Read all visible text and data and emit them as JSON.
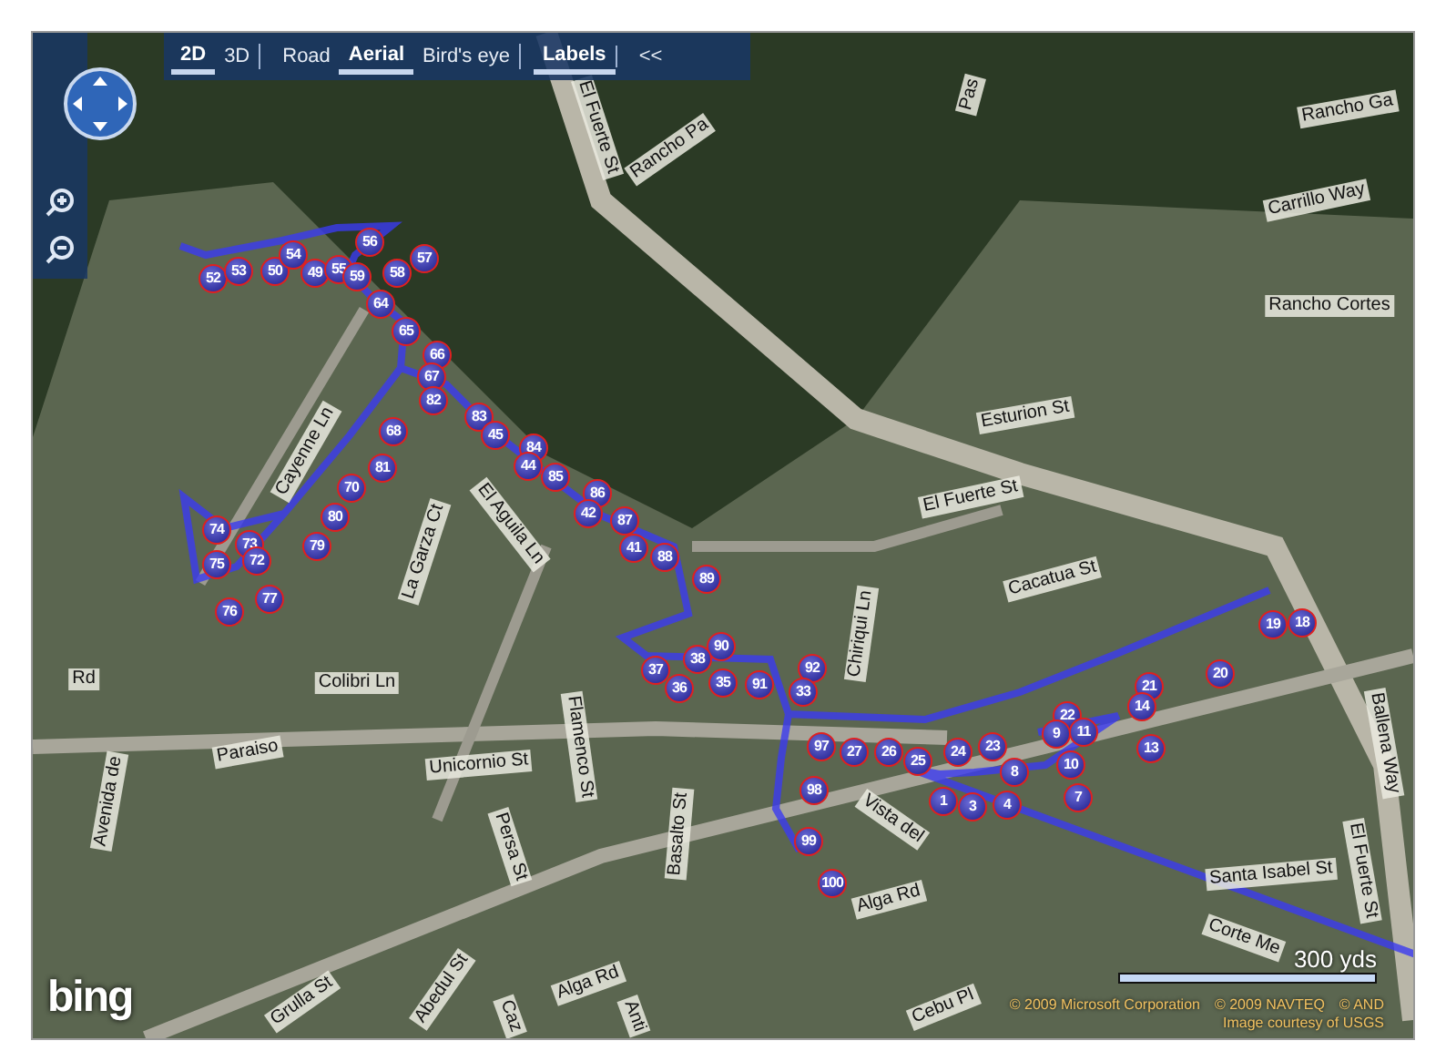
{
  "toolbar": {
    "items": [
      {
        "label": "2D",
        "selected": true,
        "separator_after": false
      },
      {
        "label": "3D",
        "selected": false,
        "separator_after": true
      },
      {
        "label": "Road",
        "selected": false,
        "separator_after": false
      },
      {
        "label": "Aerial",
        "selected": true,
        "separator_after": false
      },
      {
        "label": "Bird's eye",
        "selected": false,
        "separator_after": true
      },
      {
        "label": "Labels",
        "selected": true,
        "separator_after": true
      },
      {
        "label": "<<",
        "selected": false,
        "separator_after": false
      }
    ]
  },
  "street_labels": [
    {
      "text": "Pas"
    },
    {
      "text": "Rancho Ga"
    },
    {
      "text": "El Fuerte St"
    },
    {
      "text": "Rancho Pa"
    },
    {
      "text": "Carrillo Way"
    },
    {
      "text": "Rancho Cortes"
    },
    {
      "text": "Esturion St"
    },
    {
      "text": "El Fuerte St"
    },
    {
      "text": "Cayenne Ln"
    },
    {
      "text": "La Garza Ct"
    },
    {
      "text": "El Aguila Ln"
    },
    {
      "text": "Cacatua St"
    },
    {
      "text": "Chiriqui Ln"
    },
    {
      "text": "Colibri Ln"
    },
    {
      "text": "Flamenco St"
    },
    {
      "text": "Unicornio St"
    },
    {
      "text": "Basalto St"
    },
    {
      "text": "Vista del"
    },
    {
      "text": "Alga Rd"
    },
    {
      "text": "Santa Isabel St"
    },
    {
      "text": "Corte Me"
    },
    {
      "text": "Avenida de"
    },
    {
      "text": "Paraiso"
    },
    {
      "text": "Rd"
    },
    {
      "text": "Persa St"
    },
    {
      "text": "Grulla St"
    },
    {
      "text": "Abedul St"
    },
    {
      "text": "Alga Rd"
    },
    {
      "text": "Cebu Pl"
    },
    {
      "text": "Caz"
    },
    {
      "text": "Anti"
    },
    {
      "text": "El Fuerte St"
    },
    {
      "text": "Ballena Way"
    }
  ],
  "markers": [
    {
      "label": "52"
    },
    {
      "label": "53"
    },
    {
      "label": "50"
    },
    {
      "label": "54"
    },
    {
      "label": "49"
    },
    {
      "label": "55"
    },
    {
      "label": "56"
    },
    {
      "label": "59"
    },
    {
      "label": "58"
    },
    {
      "label": "57"
    },
    {
      "label": "64"
    },
    {
      "label": "65"
    },
    {
      "label": "66"
    },
    {
      "label": "67"
    },
    {
      "label": "82"
    },
    {
      "label": "83"
    },
    {
      "label": "45"
    },
    {
      "label": "84"
    },
    {
      "label": "44"
    },
    {
      "label": "85"
    },
    {
      "label": "68"
    },
    {
      "label": "81"
    },
    {
      "label": "70"
    },
    {
      "label": "80"
    },
    {
      "label": "86"
    },
    {
      "label": "42"
    },
    {
      "label": "87"
    },
    {
      "label": "41"
    },
    {
      "label": "88"
    },
    {
      "label": "89"
    },
    {
      "label": "74"
    },
    {
      "label": "73"
    },
    {
      "label": "72"
    },
    {
      "label": "79"
    },
    {
      "label": "75"
    },
    {
      "label": "77"
    },
    {
      "label": "76"
    },
    {
      "label": "90"
    },
    {
      "label": "38"
    },
    {
      "label": "37"
    },
    {
      "label": "36"
    },
    {
      "label": "35"
    },
    {
      "label": "91"
    },
    {
      "label": "92"
    },
    {
      "label": "33"
    },
    {
      "label": "97"
    },
    {
      "label": "27"
    },
    {
      "label": "26"
    },
    {
      "label": "25"
    },
    {
      "label": "24"
    },
    {
      "label": "23"
    },
    {
      "label": "1"
    },
    {
      "label": "3"
    },
    {
      "label": "4"
    },
    {
      "label": "8"
    },
    {
      "label": "10"
    },
    {
      "label": "7"
    },
    {
      "label": "22"
    },
    {
      "label": "9"
    },
    {
      "label": "11"
    },
    {
      "label": "21"
    },
    {
      "label": "14"
    },
    {
      "label": "13"
    },
    {
      "label": "20"
    },
    {
      "label": "19"
    },
    {
      "label": "18"
    },
    {
      "label": "98"
    },
    {
      "label": "99"
    },
    {
      "label": "100"
    }
  ],
  "scale": {
    "label": "300 yds"
  },
  "logo": {
    "text": "bing"
  },
  "copyright": [
    "© 2009 Microsoft Corporation",
    "© 2009 NAVTEQ",
    "© AND"
  ],
  "image_credit": "Image courtesy of USGS"
}
